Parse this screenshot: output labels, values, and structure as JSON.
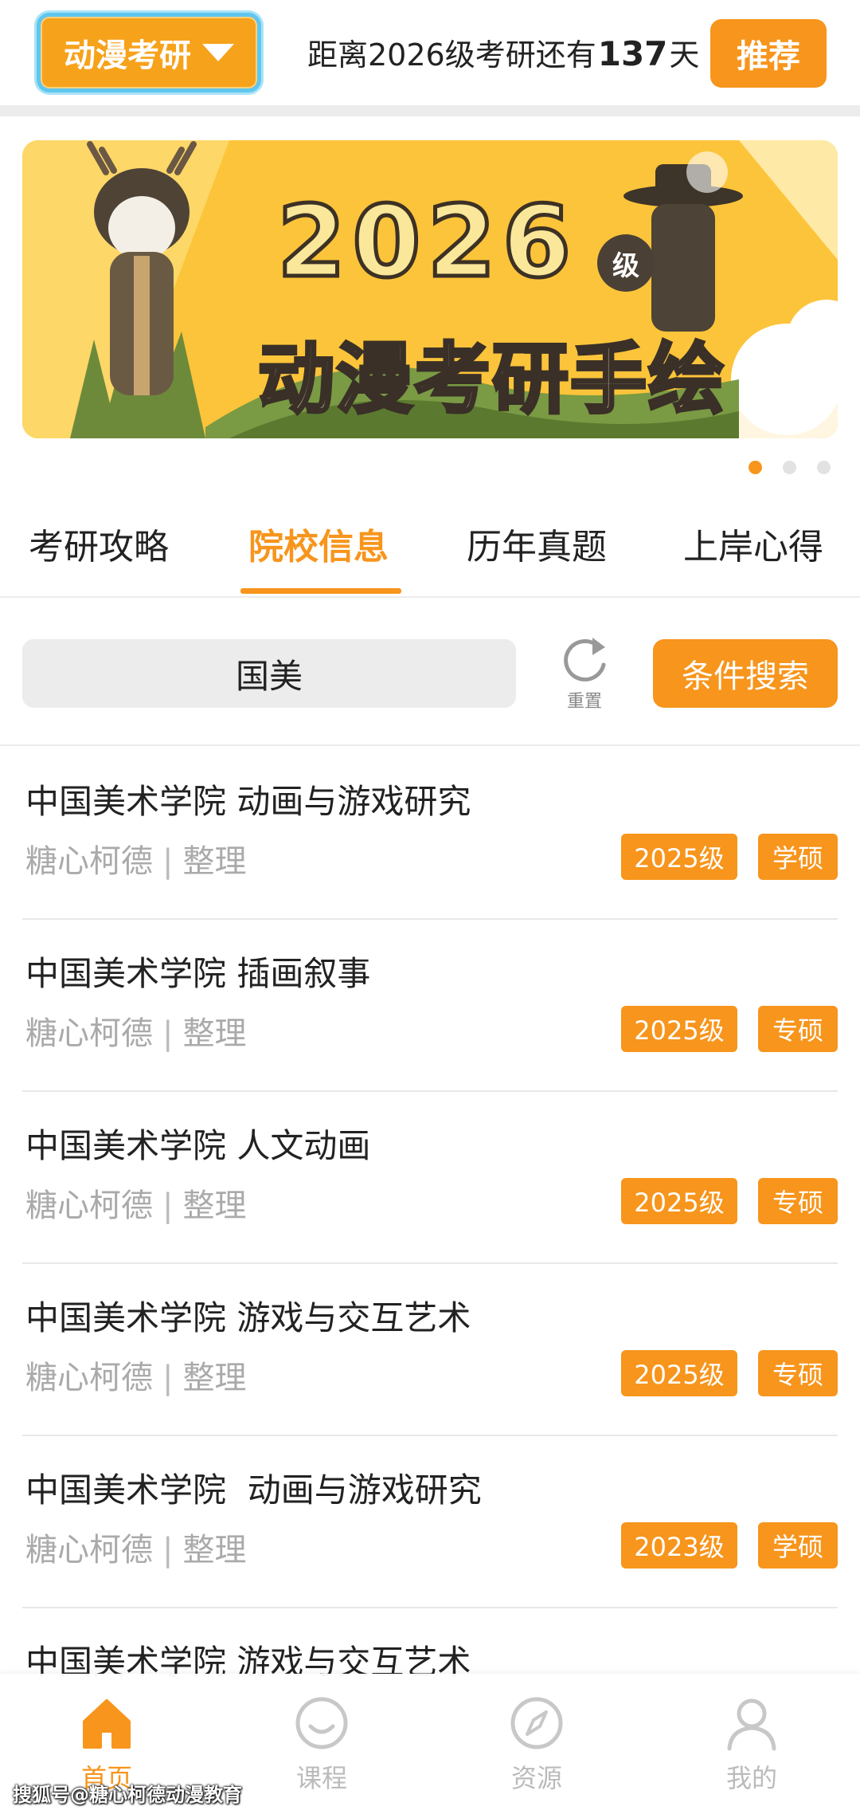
{
  "header": {
    "subject": "动漫考研",
    "countdown_prefix": "距离2026级考研还有",
    "countdown_days": "137",
    "countdown_suffix": "天",
    "recommend_label": "推荐"
  },
  "banner": {
    "year": "2026",
    "grade": "级",
    "title": "动漫考研手绘",
    "slide_count": 3,
    "active_slide": 1
  },
  "tabs": [
    {
      "label": "考研攻略",
      "active": false
    },
    {
      "label": "院校信息",
      "active": true
    },
    {
      "label": "历年真题",
      "active": false
    },
    {
      "label": "上岸心得",
      "active": false
    }
  ],
  "search": {
    "value": "国美",
    "reset_label": "重置",
    "filter_label": "条件搜索"
  },
  "list": [
    {
      "title": "中国美术学院 动画与游戏研究",
      "author": "糖心柯德",
      "sep": "|",
      "action": "整理",
      "year_tag": "2025级",
      "type_tag": "学硕"
    },
    {
      "title": "中国美术学院 插画叙事",
      "author": "糖心柯德",
      "sep": "|",
      "action": "整理",
      "year_tag": "2025级",
      "type_tag": "专硕"
    },
    {
      "title": "中国美术学院 人文动画",
      "author": "糖心柯德",
      "sep": "|",
      "action": "整理",
      "year_tag": "2025级",
      "type_tag": "专硕"
    },
    {
      "title": "中国美术学院 游戏与交互艺术",
      "author": "糖心柯德",
      "sep": "|",
      "action": "整理",
      "year_tag": "2025级",
      "type_tag": "专硕"
    },
    {
      "title": "中国美术学院  动画与游戏研究",
      "author": "糖心柯德",
      "sep": "|",
      "action": "整理",
      "year_tag": "2023级",
      "type_tag": "学硕"
    },
    {
      "title": "中国美术学院 游戏与交互艺术"
    }
  ],
  "bottom_nav": [
    {
      "label": "首页",
      "icon": "home-icon",
      "active": true
    },
    {
      "label": "课程",
      "icon": "smile-icon",
      "active": false
    },
    {
      "label": "资源",
      "icon": "compass-icon",
      "active": false
    },
    {
      "label": "我的",
      "icon": "user-icon",
      "active": false
    }
  ],
  "watermark": "搜狐号@糖心柯德动漫教育",
  "colors": {
    "accent": "#f7951c",
    "banner_bg": "#fcc43a",
    "subject_border": "#5fc6ef"
  }
}
